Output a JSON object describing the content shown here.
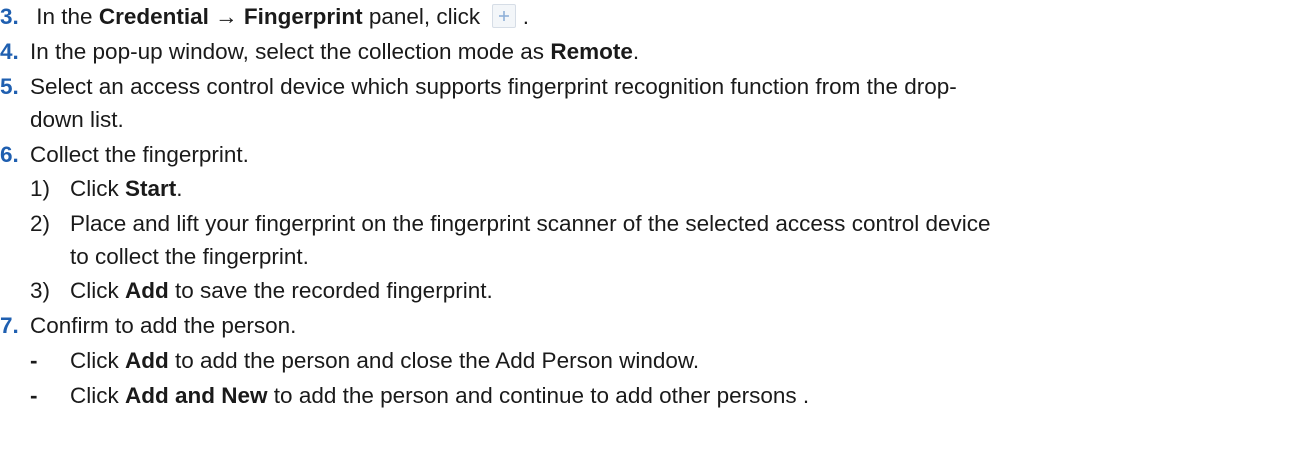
{
  "steps": {
    "s3": {
      "num": "3.",
      "pre": "In the",
      "bold": "Credential → Fingerprint",
      "mid": "panel, click",
      "post": ".",
      "icon": "plus-icon"
    },
    "s4": {
      "num": "4.",
      "pre": "In the pop-up window, select the collection mode as",
      "bold": "Remote",
      "post": "."
    },
    "s5": {
      "num": "5.",
      "line1": "Select an access control device which supports fingerprint recognition function from the drop-",
      "line2": "down list."
    },
    "s6": {
      "num": "6.",
      "text": "Collect the fingerprint.",
      "sub1": {
        "num": "1)",
        "pre": "Click",
        "bold": "Start",
        "post": "."
      },
      "sub2": {
        "num": "2)",
        "line1": "Place and lift your fingerprint on the fingerprint scanner of the selected access control device",
        "line2": "to collect the fingerprint."
      },
      "sub3": {
        "num": "3)",
        "pre": "Click",
        "bold": "Add",
        "post": "to save the recorded fingerprint."
      }
    },
    "s7": {
      "num": "7.",
      "text": "Confirm to add the person.",
      "b1": {
        "dash": "-",
        "pre": "Click",
        "bold": "Add",
        "post": "to add the person and close the Add Person window."
      },
      "b2": {
        "dash": "-",
        "pre": "Click",
        "bold": "Add and New",
        "post": "to add the person and continue to add other persons ."
      }
    }
  }
}
